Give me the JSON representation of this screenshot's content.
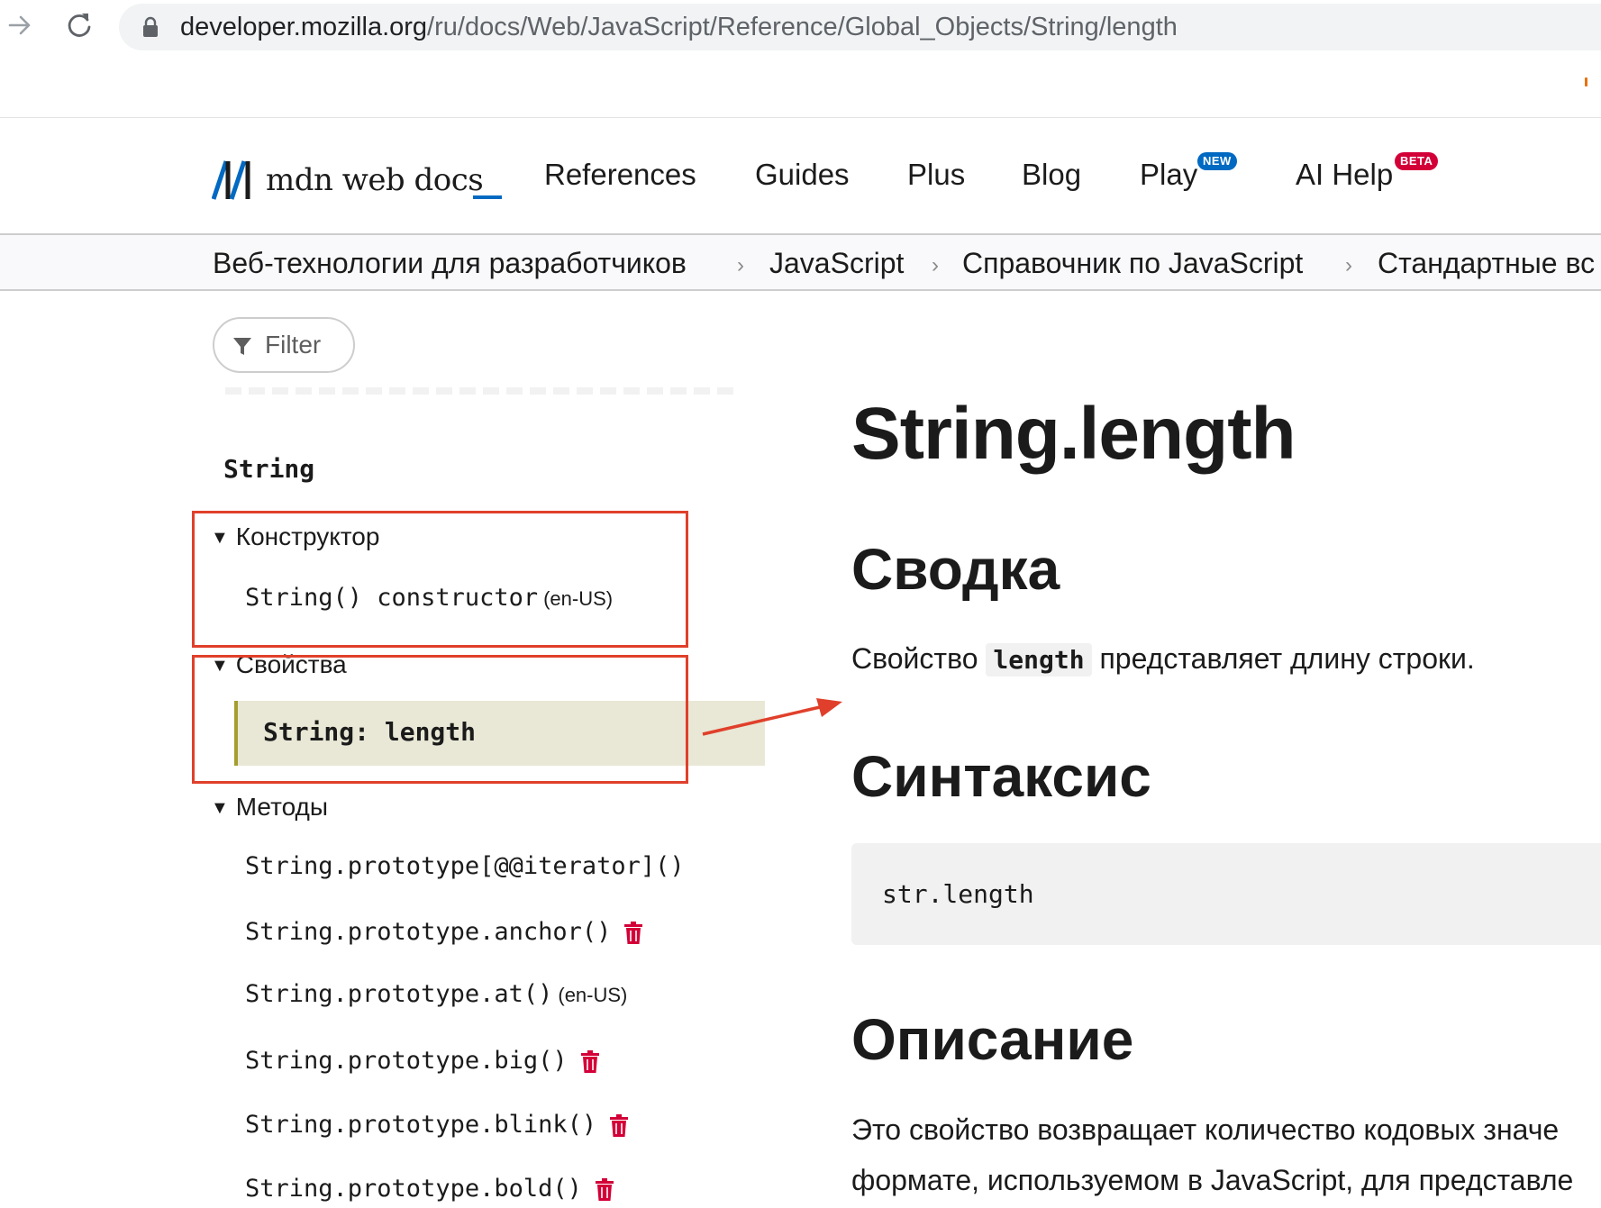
{
  "browser": {
    "url_domain": "developer.mozilla.org",
    "url_path": "/ru/docs/Web/JavaScript/Reference/Global_Objects/String/length",
    "icons": [
      "forward-arrow-icon",
      "reload-icon",
      "lock-icon"
    ]
  },
  "header": {
    "logo_text": "mdn web docs",
    "menu": [
      "References",
      "Guides",
      "Plus",
      "Blog",
      "Play",
      "AI Help"
    ],
    "badge_new": "NEW",
    "badge_beta": "BETA"
  },
  "breadcrumb": [
    "Веб-технологии для разработчиков",
    "JavaScript",
    "Справочник по JavaScript",
    "Стандартные вс"
  ],
  "sidebar": {
    "filter_label": "Filter",
    "title": "String",
    "sections": {
      "constructor": "Конструктор",
      "properties": "Свойства",
      "methods": "Методы"
    },
    "constructor_item": "String() constructor",
    "constructor_locale": "(en-US)",
    "active_item": "String: length",
    "methods": [
      {
        "name": "String.prototype[@@iterator]()"
      },
      {
        "name": "String.prototype.anchor()",
        "deprecated_icon": "trash-icon"
      },
      {
        "name": "String.prototype.at()",
        "locale": "(en-US)"
      },
      {
        "name": "String.prototype.big()",
        "deprecated_icon": "trash-icon"
      },
      {
        "name": "String.prototype.blink()",
        "deprecated_icon": "trash-icon"
      },
      {
        "name": "String.prototype.bold()",
        "deprecated_icon": "trash-icon"
      }
    ]
  },
  "main": {
    "title": "String.length",
    "h_summary": "Сводка",
    "summary_before": "Свойство ",
    "summary_code": "length",
    "summary_after": " представляет длину строки.",
    "h_syntax": "Синтаксис",
    "syntax_code": "str.length",
    "h_description": "Описание",
    "desc_line1": "Это свойство возвращает количество кодовых значе",
    "desc_line2": "формате, используемом в JavaScript, для представле"
  },
  "colors": {
    "annotation_red": "#e0402b",
    "active_bg": "#e9e8d6",
    "active_bar": "#a59e2f",
    "deprecated_red": "#d30038",
    "mdn_blue": "#0069c2"
  }
}
